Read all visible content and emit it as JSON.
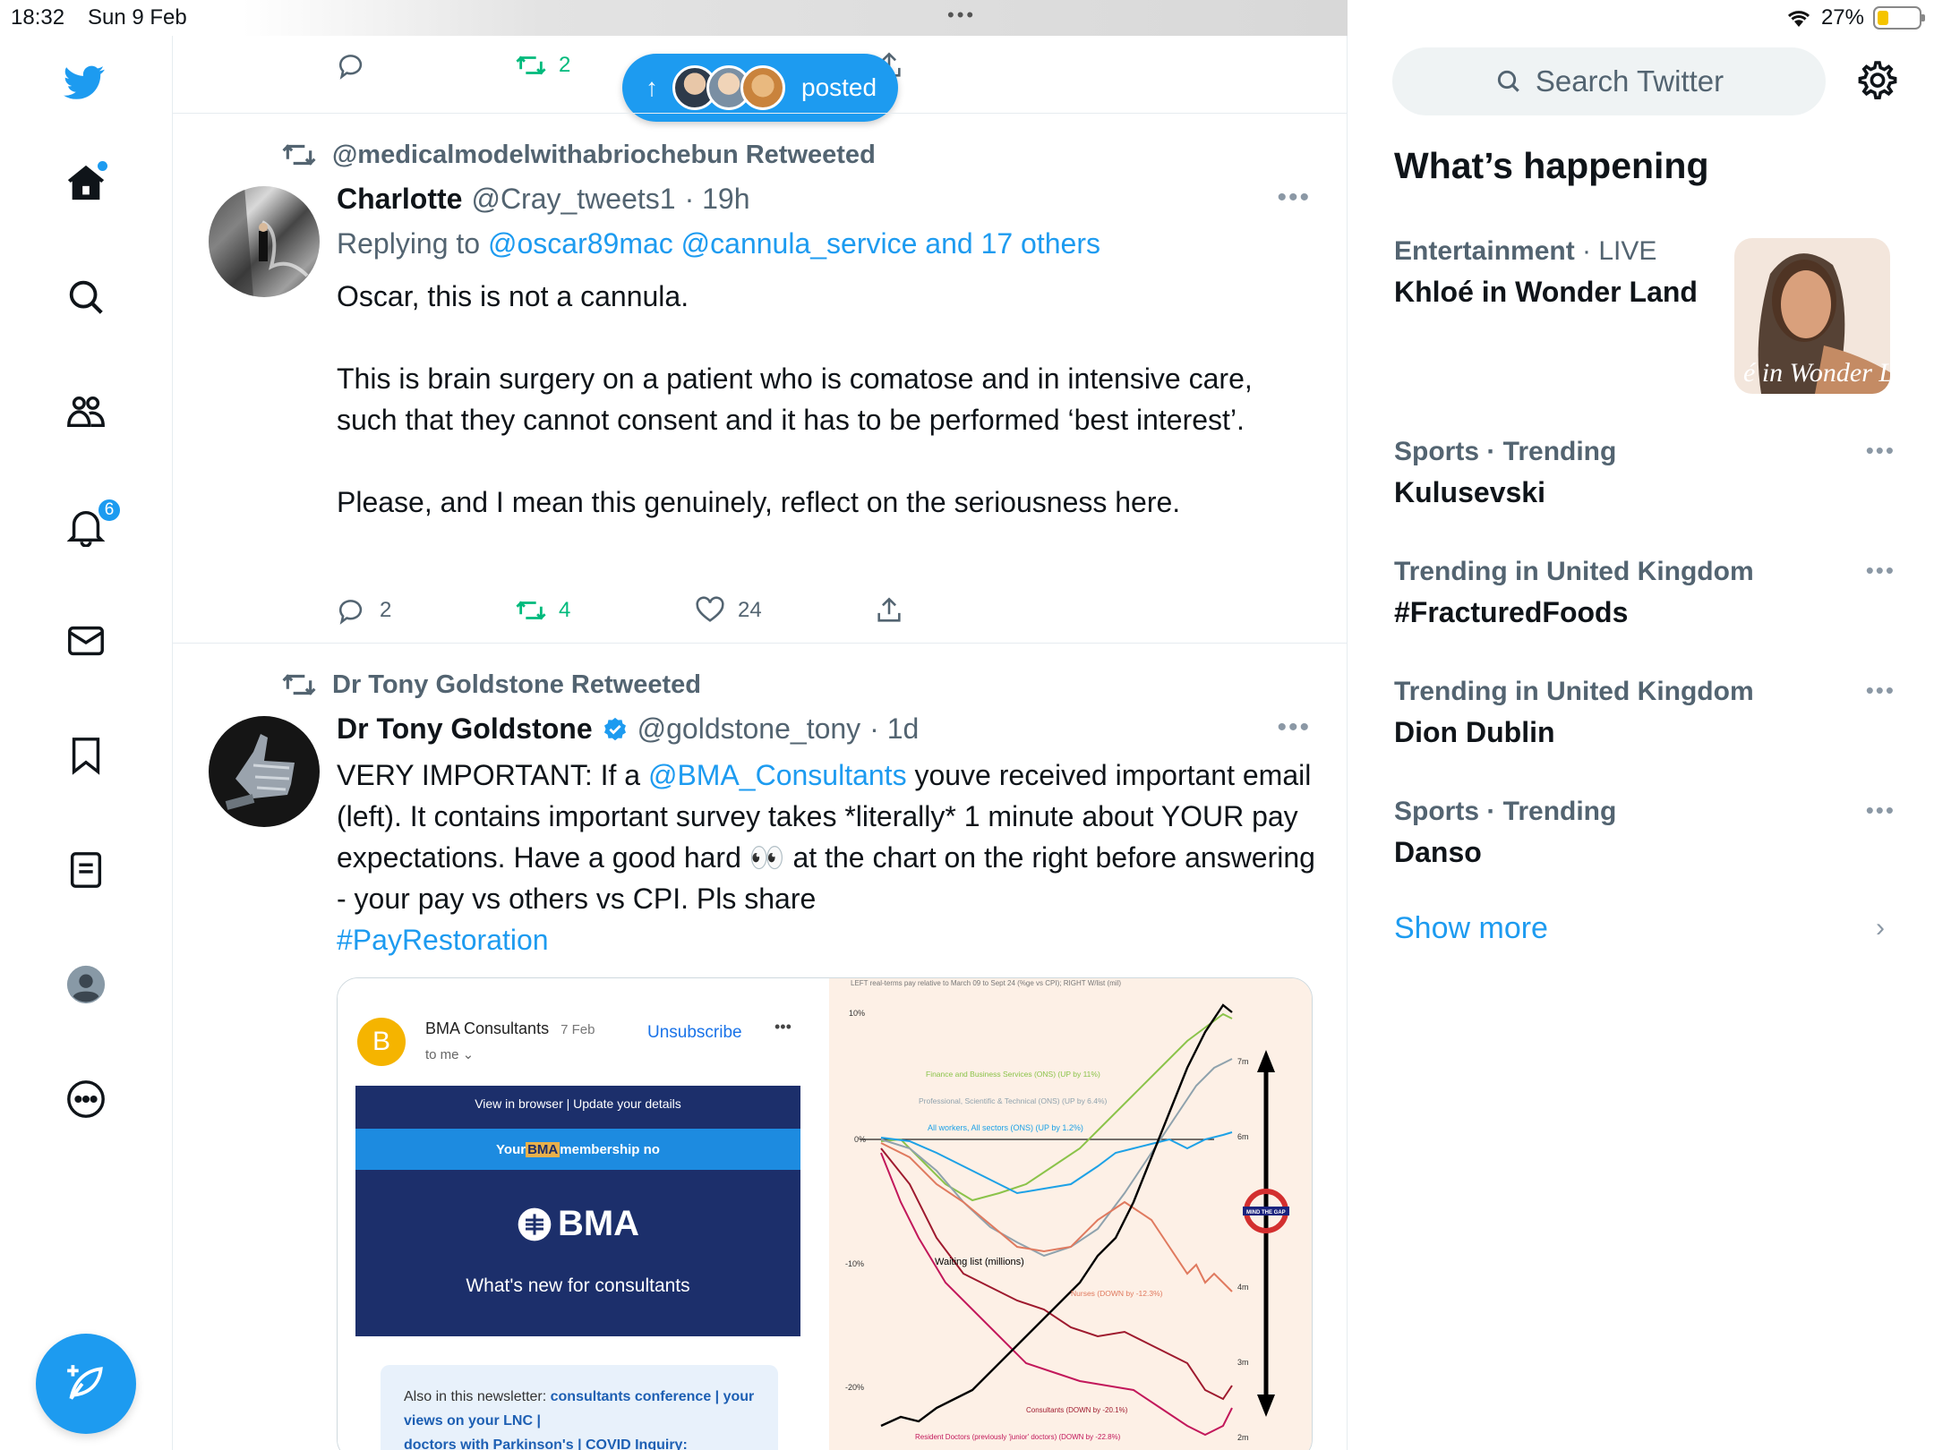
{
  "status": {
    "time": "18:32",
    "date": "Sun 9 Feb",
    "battery": "27%",
    "battery_level": 0.27
  },
  "nav": {
    "notifications_count": "6"
  },
  "pill": {
    "label": "posted"
  },
  "tweet0": {
    "reply_count": "",
    "retweet_count": "2"
  },
  "tweet1": {
    "retweeted_by": "@medicalmodelwithabriochebun Retweeted",
    "name": "Charlotte",
    "handle": "@Cray_tweets1",
    "time": "· 19h",
    "replying_prefix": "Replying to",
    "replying_to": "@oscar89mac @cannula_service and 17 others",
    "paragraphs": [
      "Oscar, this is not a cannula.",
      "This is brain surgery on a patient who is comatose and in intensive care, such that they cannot consent and it has to be performed ‘best interest’.",
      "Please, and I mean this genuinely, reflect on the seriousness here."
    ],
    "reply_count": "2",
    "retweet_count": "4",
    "like_count": "24"
  },
  "tweet2": {
    "retweeted_by": "Dr Tony Goldstone Retweeted",
    "name": "Dr Tony Goldstone",
    "handle": "@goldstone_tony",
    "time": "· 1d",
    "text_a": "VERY IMPORTANT: If a ",
    "mention": "@BMA_Consultants",
    "text_b": " youve received important email (left). It contains important survey takes *literally* 1 minute about YOUR pay expectations. Have a good hard 👀 at the chart on the right before answering - your pay vs others vs CPI. Pls share",
    "hashtag": "#PayRestoration",
    "email": {
      "sender_initial": "B",
      "sender": "BMA Consultants",
      "date": "7 Feb",
      "to": "to me ⌄",
      "unsubscribe": "Unsubscribe",
      "view_browser": "View in browser  |  Update your details",
      "membership_a": "Your ",
      "membership_brand": "BMA",
      "membership_b": " membership no",
      "logo": "BMA",
      "headline": "What's new for consultants",
      "also_prefix": "Also in this newsletter: ",
      "also_link1": "consultants conference | your views on your LNC |",
      "also_link2": "doctors with Parkinson's | COVID Inquiry:"
    },
    "chart": {
      "caption": "LEFT real-terms pay relative to March 09 to Sept 24 (%ge vs CPI); RIGHT W/list (mil)",
      "left_ticks": [
        "10%",
        "0%",
        "-10%",
        "-20%"
      ],
      "right_ticks": [
        "7m",
        "6m",
        "4m",
        "3m",
        "2m"
      ],
      "labels": {
        "finance": "Finance and Business Services (ONS) (UP by 11%)",
        "professional": "Professional, Scientific & Technical (ONS) (UP by 6.4%)",
        "allworkers": "All workers, All sectors (ONS) (UP by 1.2%)",
        "waiting": "Waiting list (millions)",
        "nurses": "Nurses (DOWN by -12.3%)",
        "consultants": "Consultants (DOWN by -20.1%)",
        "resident": "Resident Doctors (previously 'junior' doctors) (DOWN by -22.8%)",
        "mindgap": "MIND THE GAP"
      }
    }
  },
  "right": {
    "search_placeholder": "Search Twitter",
    "title": "What’s happening",
    "trends": [
      {
        "category": "Entertainment",
        "extra": " · LIVE",
        "title": "Khloé in Wonder Land",
        "image_text": "é in Wonder L"
      },
      {
        "category": "Sports · Trending",
        "extra": "",
        "title": "Kulusevski"
      },
      {
        "category": "Trending in United Kingdom",
        "extra": "",
        "title": "#FracturedFoods"
      },
      {
        "category": "Trending in United Kingdom",
        "extra": "",
        "title": "Dion Dublin"
      },
      {
        "category": "Sports · Trending",
        "extra": "",
        "title": "Danso"
      }
    ],
    "show_more": "Show more"
  },
  "colors": {
    "accent": "#1d9bf0",
    "retweet": "#00ba7c",
    "muted": "#536471",
    "bma_navy": "#1c2f6b"
  }
}
